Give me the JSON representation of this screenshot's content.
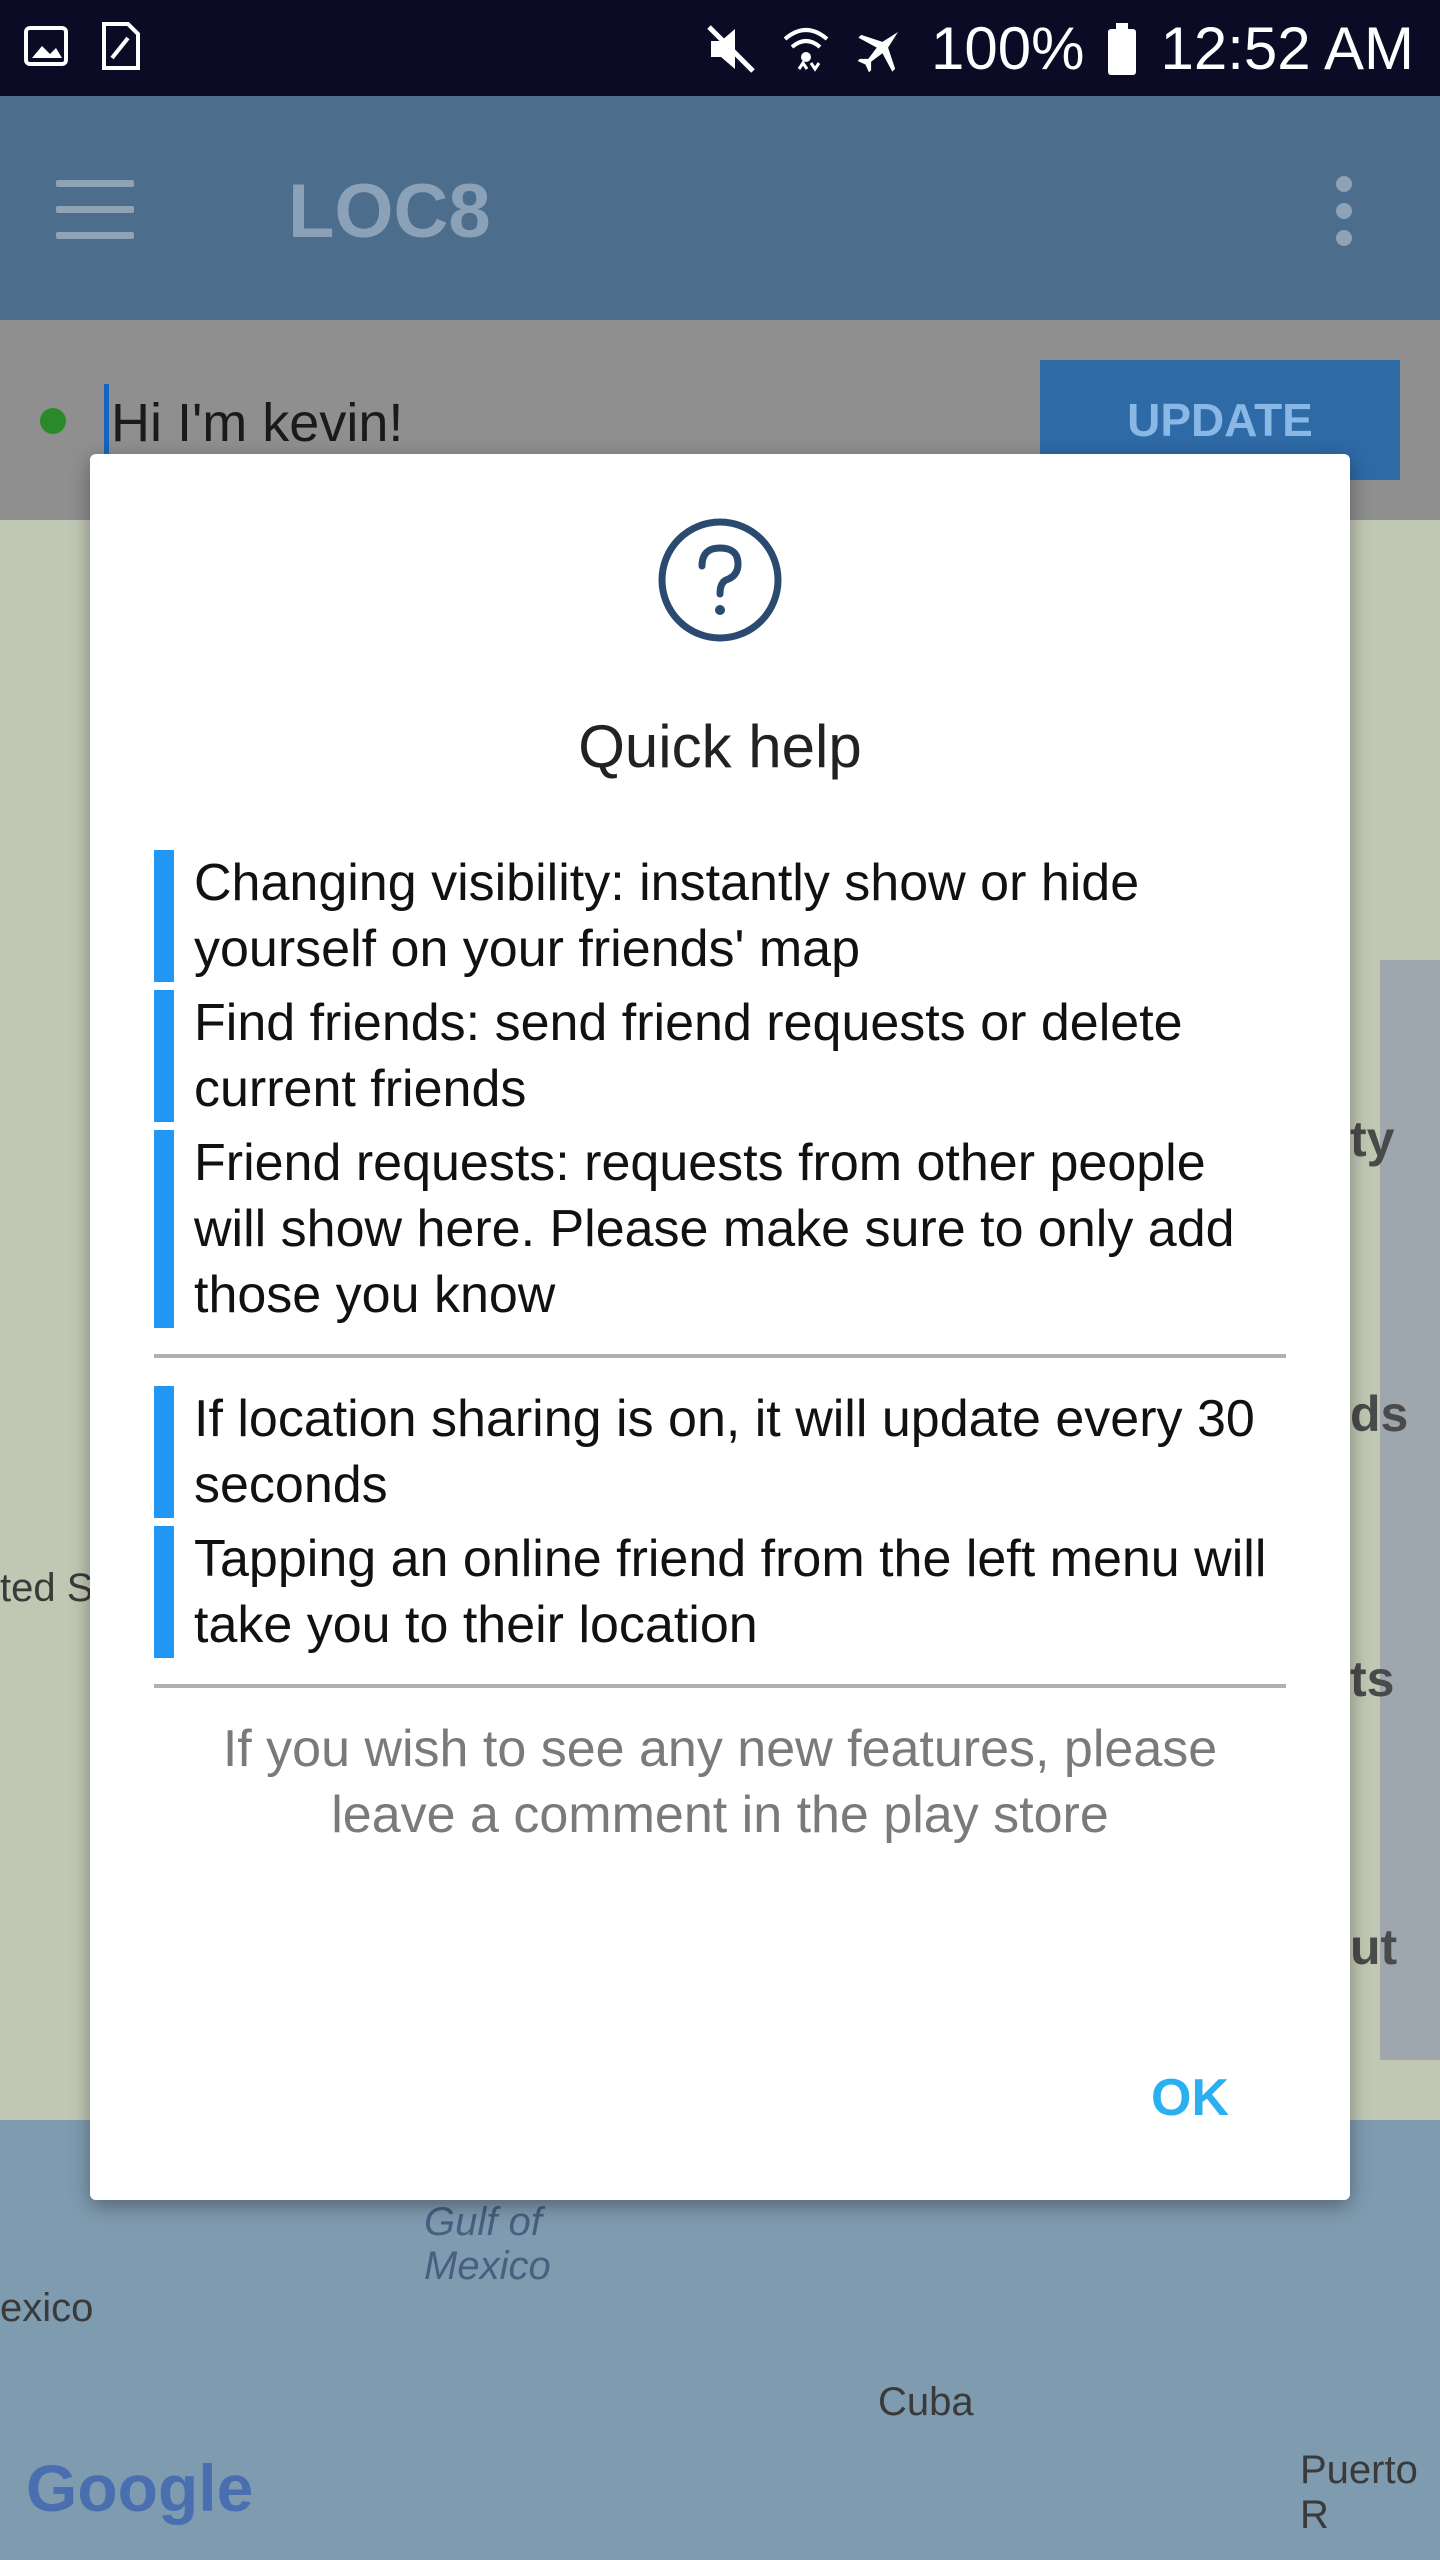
{
  "status_bar": {
    "battery": "100%",
    "time": "12:52 AM"
  },
  "app": {
    "title": "LOC8"
  },
  "status_row": {
    "input_value": "Hi I'm kevin!",
    "update_label": "UPDATE"
  },
  "map": {
    "labels": [
      "Gulf of",
      "Mexico",
      "exico",
      "Cuba",
      "Puerto R",
      "ted S"
    ],
    "logo": "Google"
  },
  "side_menu_partial": [
    "ty",
    "ds",
    "ts",
    "ut"
  ],
  "dialog": {
    "title": "Quick help",
    "tips_group1": [
      "Changing visibility: instantly show or hide yourself on your friends' map",
      "Find friends: send friend requests or delete current friends",
      "Friend requests: requests from other people will show here. Please make sure to only add those you know"
    ],
    "tips_group2": [
      "If location sharing is on, it will update every 30 seconds",
      "Tapping an online friend from the left menu will take you to their location"
    ],
    "footer": "If you wish to see any new features, please leave a comment in the play store",
    "ok_label": "OK"
  },
  "colors": {
    "accent": "#2196f3",
    "ok_text": "#2ab0f0",
    "appbar": "#4d6d8c"
  }
}
